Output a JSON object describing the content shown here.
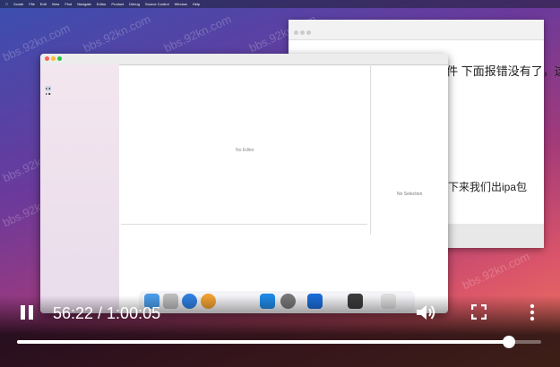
{
  "video": {
    "time_display": "56:22 / 1:00:05",
    "progress_fraction": 0.9383
  },
  "screen": {
    "watermark": "bbs.92kn.com",
    "doc_text_1": "回到 Xcode 再选择导入描述文件 下面报错没有了，这时候",
    "doc_text_2": "下来我们出ipa包",
    "xcode": {
      "no_editor": "No Editor",
      "no_selection": "No Selection"
    }
  },
  "colors": {
    "progress_fill": "#ffffff",
    "progress_track": "#8a8a8a"
  },
  "icons": [
    "pause-icon",
    "volume-icon",
    "fullscreen-icon",
    "more-vert-icon"
  ]
}
